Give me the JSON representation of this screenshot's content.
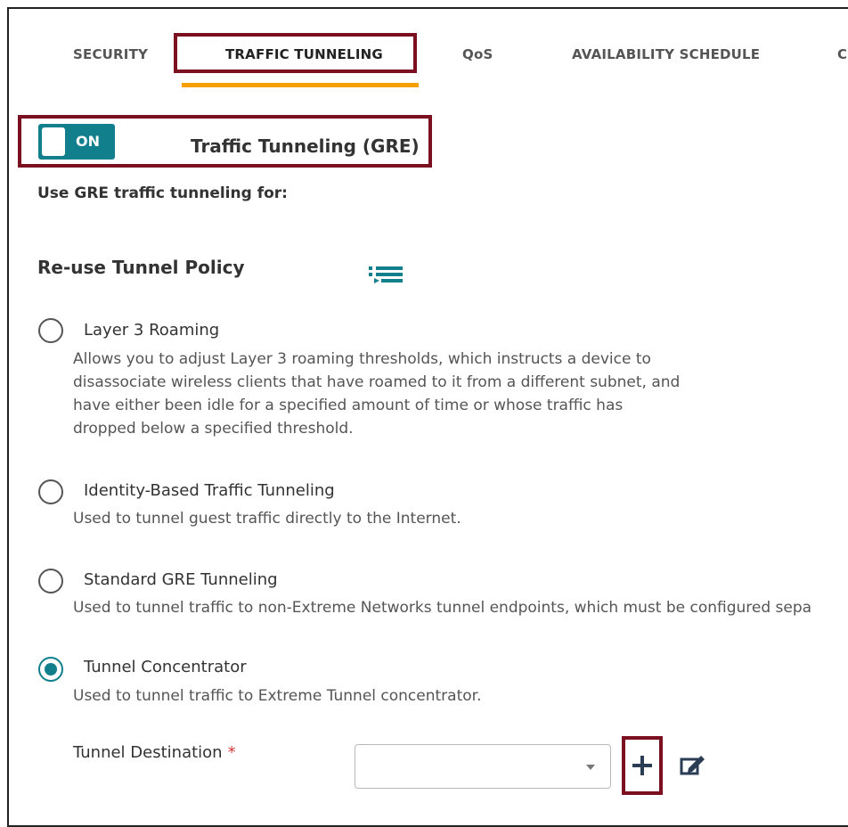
{
  "tabs": [
    {
      "label": "SECURITY"
    },
    {
      "label": "TRAFFIC TUNNELING",
      "active": true
    },
    {
      "label": "QoS"
    },
    {
      "label": "AVAILABILITY SCHEDULE"
    },
    {
      "label": "C"
    }
  ],
  "toggle": {
    "state_label": "ON",
    "title": "Traffic Tunneling (GRE)",
    "enabled": true
  },
  "subheading": "Use GRE traffic tunneling for:",
  "policy": {
    "title": "Re-use Tunnel Policy",
    "icon": "list-icon"
  },
  "options": [
    {
      "label": "Layer 3 Roaming",
      "selected": false,
      "description": [
        "Allows you to adjust Layer 3 roaming thresholds, which instructs a device to",
        "disassociate wireless clients that have roamed to it from a different subnet, and",
        "have either been idle for a specified amount of time or whose traffic has",
        "dropped below a specified threshold."
      ]
    },
    {
      "label": "Identity-Based Traffic Tunneling",
      "selected": false,
      "description": [
        "Used to tunnel guest traffic directly to the Internet."
      ]
    },
    {
      "label": "Standard GRE Tunneling",
      "selected": false,
      "description": [
        "Used to tunnel traffic to non-Extreme Networks tunnel endpoints, which must be configured sepa"
      ]
    },
    {
      "label": "Tunnel Concentrator",
      "selected": true,
      "description": [
        "Used to tunnel traffic to Extreme Tunnel concentrator."
      ]
    }
  ],
  "tunnel_destination": {
    "label": "Tunnel Destination",
    "required_mark": "*",
    "value": ""
  },
  "icons": {
    "add": "plus-icon",
    "edit": "edit-icon",
    "caret": "chevron-down-icon"
  },
  "colors": {
    "accent": "#127f8c",
    "tab_underline": "#f5a000",
    "highlight": "#7a1020",
    "required": "#d43c3c"
  }
}
